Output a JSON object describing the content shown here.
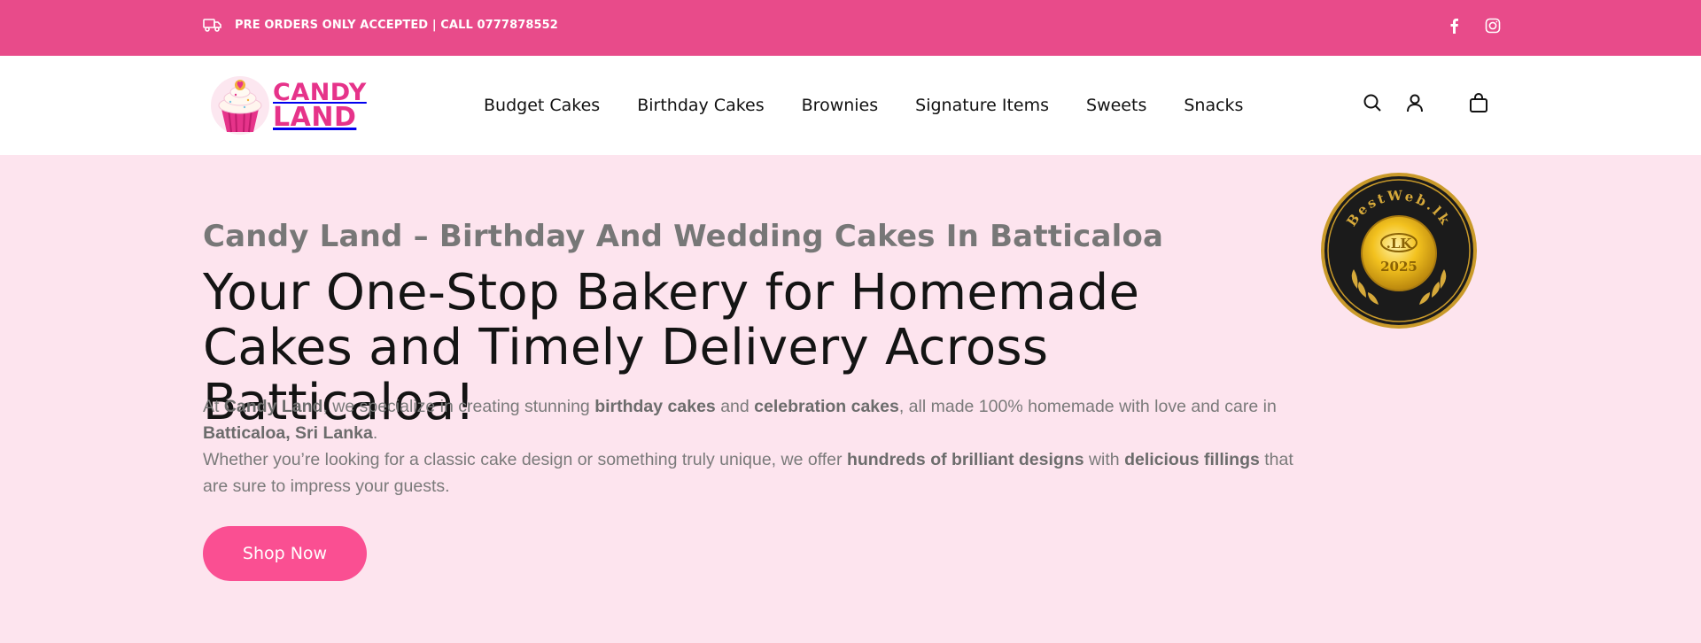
{
  "topbar": {
    "notice": "PRE ORDERS ONLY ACCEPTED | CALL 0777878552",
    "social": [
      "facebook-icon",
      "instagram-icon"
    ],
    "bg_color": "#e84b8a"
  },
  "header": {
    "logo": {
      "line1": "CANDY",
      "line2": "LAND"
    },
    "nav": [
      "Budget Cakes",
      "Birthday Cakes",
      "Brownies",
      "Signature Items",
      "Sweets",
      "Snacks"
    ],
    "icons": [
      "search-icon",
      "user-icon",
      "cart-icon"
    ]
  },
  "hero": {
    "subtitle": "Candy Land – Birthday And Wedding Cakes In Batticaloa",
    "headline": "Your One-Stop Bakery for Homemade Cakes and Timely Delivery Across Batticaloa!",
    "p1": {
      "t1": "At ",
      "b1": "Candy Land",
      "t2": ", we specialize in creating stunning ",
      "b2": "birthday cakes",
      "t3": " and ",
      "b3": "celebration cakes",
      "t4": ", all made 100% homemade with love and care in ",
      "b4": "Batticaloa, Sri Lanka",
      "t5": "."
    },
    "p2": {
      "t1": "Whether you’re looking for a classic cake design or something truly unique, we offer ",
      "b1": "hundreds of brilliant designs",
      "t2": " with ",
      "b2": "delicious fillings",
      "t3": " that are sure to impress your guests."
    },
    "cta": "Shop Now",
    "badge": {
      "arc_text": "BestWeb.lk",
      "center": ".LK",
      "year": "2025"
    },
    "bg_color": "#fde4ee",
    "cta_color": "#fa4f92"
  }
}
